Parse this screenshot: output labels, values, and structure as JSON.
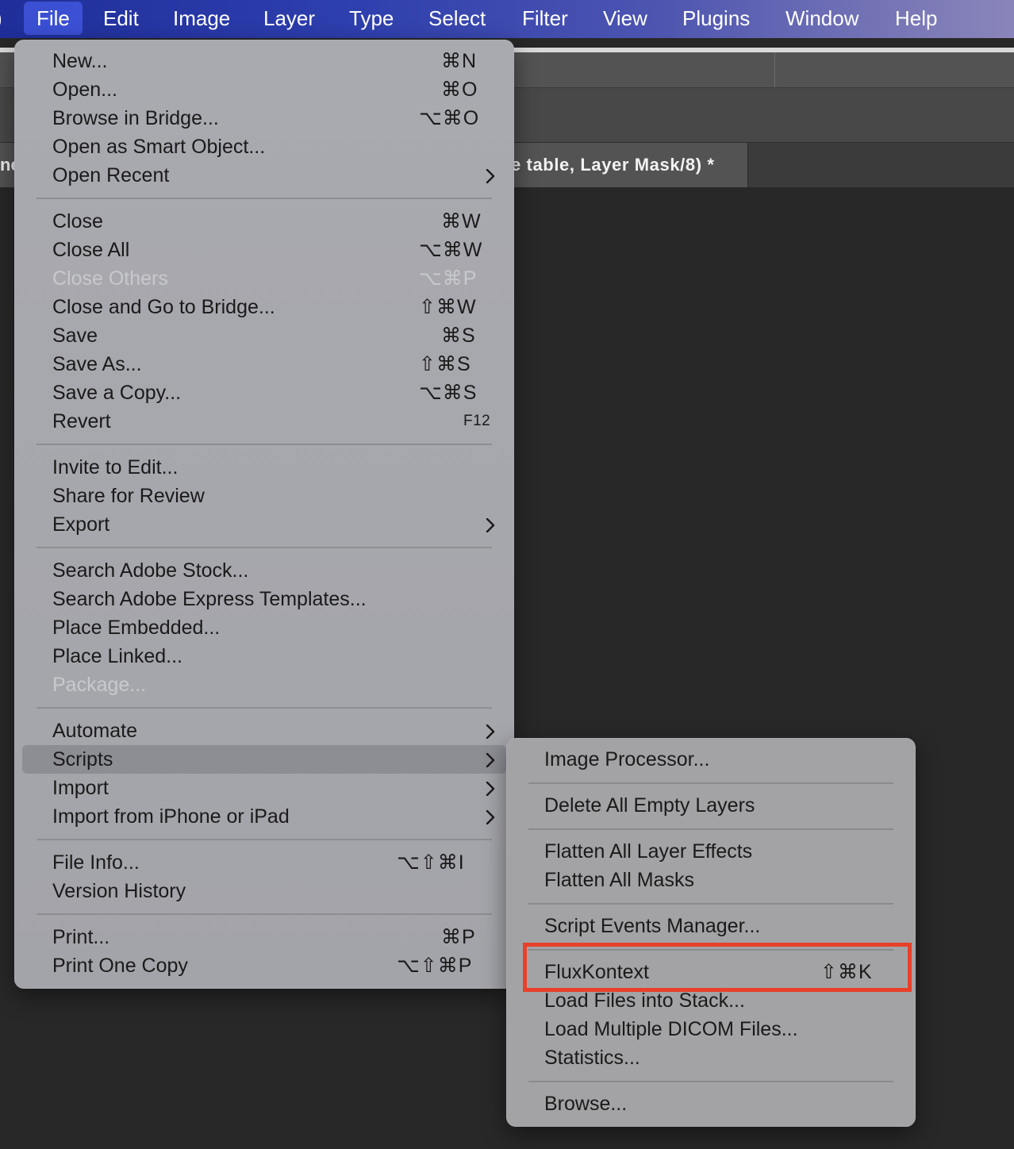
{
  "menubar": {
    "apple_stub": ")",
    "items": [
      {
        "label": "File"
      },
      {
        "label": "Edit"
      },
      {
        "label": "Image"
      },
      {
        "label": "Layer"
      },
      {
        "label": "Type"
      },
      {
        "label": "Select"
      },
      {
        "label": "Filter"
      },
      {
        "label": "View"
      },
      {
        "label": "Plugins"
      },
      {
        "label": "Window"
      },
      {
        "label": "Help"
      }
    ]
  },
  "document": {
    "tab_title": "e table, Layer Mask/8) *",
    "left_tab_stub": "ne"
  },
  "file_menu": {
    "items": [
      {
        "label": "New...",
        "shortcut": "⌘N"
      },
      {
        "label": "Open...",
        "shortcut": "⌘O"
      },
      {
        "label": "Browse in Bridge...",
        "shortcut": "⌥⌘O"
      },
      {
        "label": "Open as Smart Object...",
        "shortcut": ""
      },
      {
        "label": "Open Recent",
        "shortcut": ""
      },
      {
        "label": "Close",
        "shortcut": "⌘W"
      },
      {
        "label": "Close All",
        "shortcut": "⌥⌘W"
      },
      {
        "label": "Close Others",
        "shortcut": "⌥⌘P"
      },
      {
        "label": "Close and Go to Bridge...",
        "shortcut": "⇧⌘W"
      },
      {
        "label": "Save",
        "shortcut": "⌘S"
      },
      {
        "label": "Save As...",
        "shortcut": "⇧⌘S"
      },
      {
        "label": "Save a Copy...",
        "shortcut": "⌥⌘S"
      },
      {
        "label": "Revert",
        "shortcut": "F12"
      },
      {
        "label": "Invite to Edit...",
        "shortcut": ""
      },
      {
        "label": "Share for Review",
        "shortcut": ""
      },
      {
        "label": "Export",
        "shortcut": ""
      },
      {
        "label": "Search Adobe Stock...",
        "shortcut": ""
      },
      {
        "label": "Search Adobe Express Templates...",
        "shortcut": ""
      },
      {
        "label": "Place Embedded...",
        "shortcut": ""
      },
      {
        "label": "Place Linked...",
        "shortcut": ""
      },
      {
        "label": "Package...",
        "shortcut": ""
      },
      {
        "label": "Automate",
        "shortcut": ""
      },
      {
        "label": "Scripts",
        "shortcut": ""
      },
      {
        "label": "Import",
        "shortcut": ""
      },
      {
        "label": "Import from iPhone or iPad",
        "shortcut": ""
      },
      {
        "label": "File Info...",
        "shortcut": "⌥⇧⌘I"
      },
      {
        "label": "Version History",
        "shortcut": ""
      },
      {
        "label": "Print...",
        "shortcut": "⌘P"
      },
      {
        "label": "Print One Copy",
        "shortcut": "⌥⇧⌘P"
      }
    ]
  },
  "scripts_menu": {
    "items": [
      {
        "label": "Image Processor...",
        "shortcut": ""
      },
      {
        "label": "Delete All Empty Layers",
        "shortcut": ""
      },
      {
        "label": "Flatten All Layer Effects",
        "shortcut": ""
      },
      {
        "label": "Flatten All Masks",
        "shortcut": ""
      },
      {
        "label": "Script Events Manager...",
        "shortcut": ""
      },
      {
        "label": "FluxKontext",
        "shortcut": "⇧⌘K"
      },
      {
        "label": "Load Files into Stack...",
        "shortcut": ""
      },
      {
        "label": "Load Multiple DICOM Files...",
        "shortcut": ""
      },
      {
        "label": "Statistics...",
        "shortcut": ""
      },
      {
        "label": "Browse...",
        "shortcut": ""
      }
    ]
  },
  "colors": {
    "highlight": "#e8402b",
    "menu_bg": "#a9aaae",
    "selected_bg": "#8d8e94"
  }
}
